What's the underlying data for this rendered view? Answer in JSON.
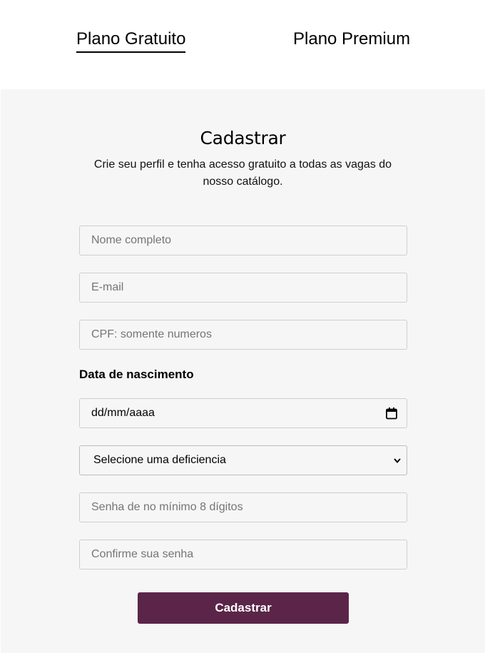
{
  "tabs": {
    "free_label": "Plano Gratuito",
    "premium_label": "Plano Premium",
    "active": "free"
  },
  "form": {
    "title": "Cadastrar",
    "subtitle": "Crie seu perfil e tenha acesso gratuito a todas as vagas do nosso catálogo.",
    "name_placeholder": "Nome completo",
    "email_placeholder": "E-mail",
    "cpf_placeholder": "CPF: somente numeros",
    "birth_label": "Data de nascimento",
    "birth_value": "dd/mm/aaaa",
    "disability_selected": "Selecione uma deficiencia",
    "password_placeholder": "Senha de no mínimo 8 dígitos",
    "confirm_placeholder": "Confirme sua senha",
    "submit_label": "Cadastrar"
  },
  "icons": {
    "date": "calendar-icon",
    "select": "chevron-down-icon"
  },
  "colors": {
    "panel_background": "#f6f6f6",
    "submit_background": "#5b2549",
    "submit_text": "#ffffff",
    "field_border": "#cfcfcf"
  }
}
